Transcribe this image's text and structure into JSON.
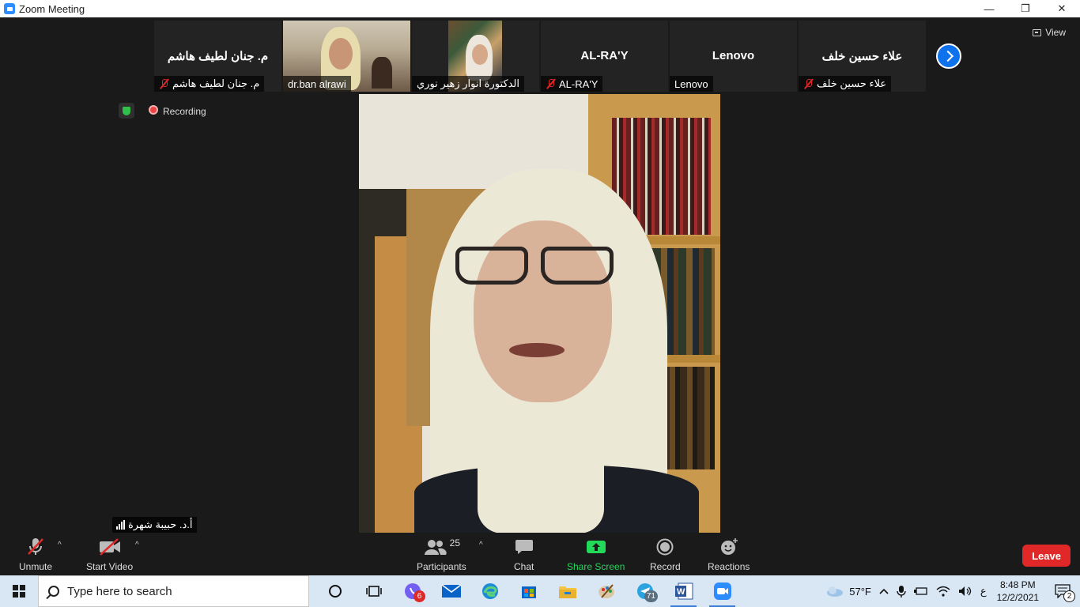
{
  "window": {
    "title": "Zoom Meeting",
    "controls": {
      "minimize": "—",
      "restore": "❐",
      "close": "✕"
    }
  },
  "view_button": {
    "label": "View",
    "icon": "view-icon"
  },
  "participants_strip": [
    {
      "big_name": "م. جنان لطيف هاشم",
      "tag": "م. جنان لطيف هاشم",
      "muted": true,
      "video": false
    },
    {
      "big_name": "",
      "tag": "dr.ban alrawi",
      "muted": false,
      "video": true
    },
    {
      "big_name": "",
      "tag": "الدكتورة انوار زهير نوري",
      "muted": false,
      "video": true
    },
    {
      "big_name": "AL-RA'Y",
      "tag": "AL-RA'Y",
      "muted": true,
      "video": false
    },
    {
      "big_name": "Lenovo",
      "tag": "Lenovo",
      "muted": false,
      "video": false
    },
    {
      "big_name": "علاء حسين خلف",
      "tag": "علاء حسين خلف",
      "muted": true,
      "video": false
    }
  ],
  "status": {
    "recording_label": "Recording"
  },
  "speaker": {
    "name": "أ.د. حبيبة شهرة"
  },
  "toolbar": {
    "unmute": "Unmute",
    "start_video": "Start Video",
    "participants": "Participants",
    "participants_count": "25",
    "chat": "Chat",
    "share_screen": "Share Screen",
    "record": "Record",
    "reactions": "Reactions",
    "leave": "Leave",
    "caret": "^"
  },
  "colors": {
    "accent": "#0e72ed",
    "leave": "#e02828",
    "share": "#23d959",
    "mute": "#e02828"
  },
  "taskbar": {
    "search_placeholder": "Type here to search",
    "badges": {
      "viber": "6",
      "telegram": "71"
    },
    "weather": "57°F",
    "lang": "ع",
    "time": "8:48 PM",
    "date": "12/2/2021",
    "notifications": "2"
  }
}
